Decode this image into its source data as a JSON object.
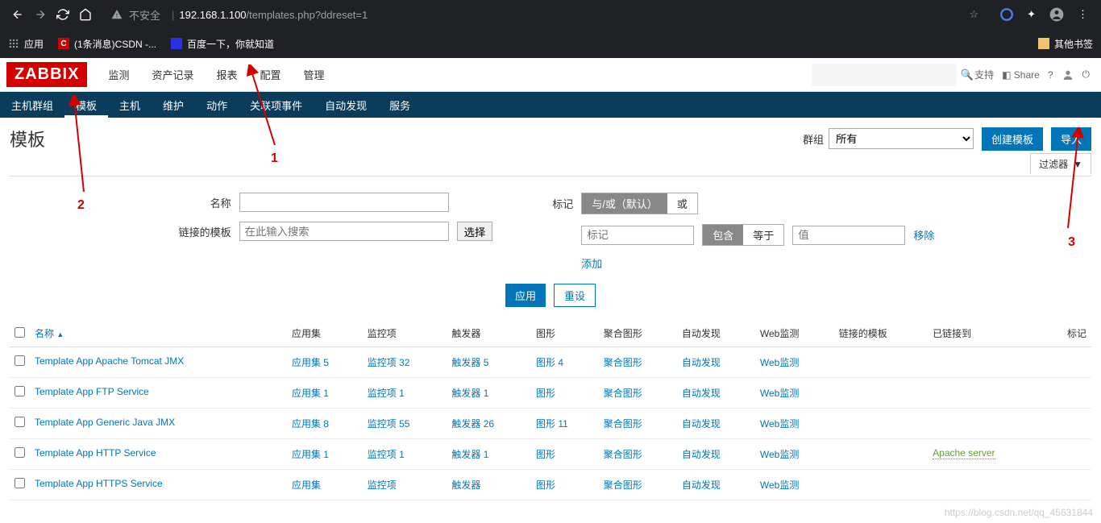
{
  "browser": {
    "url_insecure": "不安全",
    "url_host": "192.168.1.100",
    "url_path": "/templates.php?ddreset=1",
    "bookmarks": {
      "apps": "应用",
      "csdn": "(1条消息)CSDN -...",
      "baidu": "百度一下，你就知道",
      "other": "其他书签"
    }
  },
  "header": {
    "logo": "ZABBIX",
    "nav": [
      "监测",
      "资产记录",
      "报表",
      "配置",
      "管理"
    ],
    "support": "支持",
    "share": "Share"
  },
  "subnav": [
    "主机群组",
    "模板",
    "主机",
    "维护",
    "动作",
    "关联项事件",
    "自动发现",
    "服务"
  ],
  "page": {
    "title": "模板",
    "group_label": "群组",
    "group_value": "所有",
    "btn_create": "创建模板",
    "btn_import": "导入",
    "filter_tab": "过滤器"
  },
  "filter": {
    "name_label": "名称",
    "linked_label": "链接的模板",
    "linked_placeholder": "在此输入搜索",
    "select_btn": "选择",
    "tag_label": "标记",
    "tag_andor": "与/或（默认）",
    "tag_or": "或",
    "tag_placeholder": "标记",
    "contains": "包含",
    "equals": "等于",
    "value_placeholder": "值",
    "remove": "移除",
    "add": "添加",
    "apply": "应用",
    "reset": "重设"
  },
  "table": {
    "headers": {
      "name": "名称",
      "apps": "应用集",
      "items": "监控项",
      "triggers": "触发器",
      "graphs": "图形",
      "screens": "聚合图形",
      "discovery": "自动发现",
      "web": "Web监测",
      "linked": "链接的模板",
      "linkedto": "已链接到",
      "tags": "标记"
    },
    "rows": [
      {
        "name": "Template App Apache Tomcat JMX",
        "apps": "应用集 5",
        "items": "监控项 32",
        "triggers": "触发器 5",
        "graphs": "图形 4",
        "screens": "聚合图形",
        "discovery": "自动发现",
        "web": "Web监测",
        "linkedto": ""
      },
      {
        "name": "Template App FTP Service",
        "apps": "应用集 1",
        "items": "监控项 1",
        "triggers": "触发器 1",
        "graphs": "图形",
        "screens": "聚合图形",
        "discovery": "自动发现",
        "web": "Web监测",
        "linkedto": ""
      },
      {
        "name": "Template App Generic Java JMX",
        "apps": "应用集 8",
        "items": "监控项 55",
        "triggers": "触发器 26",
        "graphs": "图形 11",
        "screens": "聚合图形",
        "discovery": "自动发现",
        "web": "Web监测",
        "linkedto": ""
      },
      {
        "name": "Template App HTTP Service",
        "apps": "应用集 1",
        "items": "监控项 1",
        "triggers": "触发器 1",
        "graphs": "图形",
        "screens": "聚合图形",
        "discovery": "自动发现",
        "web": "Web监测",
        "linkedto": "Apache server"
      },
      {
        "name": "Template App HTTPS Service",
        "apps": "应用集",
        "items": "监控项",
        "triggers": "触发器",
        "graphs": "图形",
        "screens": "聚合图形",
        "discovery": "自动发现",
        "web": "Web监测",
        "linkedto": ""
      }
    ]
  },
  "annotations": {
    "a1": "1",
    "a2": "2",
    "a3": "3"
  },
  "watermark": "https://blog.csdn.net/qq_45631844"
}
